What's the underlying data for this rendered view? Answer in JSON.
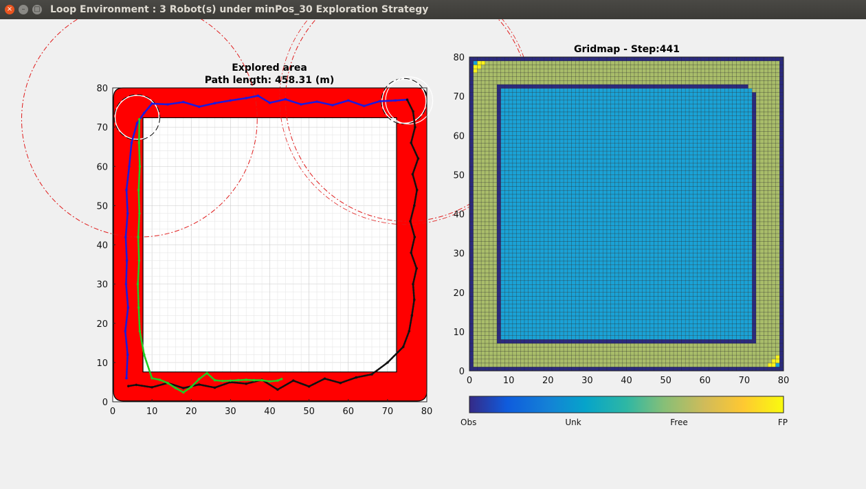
{
  "window": {
    "title": "Loop Environment : 3 Robot(s) under minPos_30 Exploration Strategy",
    "close_glyph": "×",
    "minimize_glyph": "–",
    "maximize_glyph": "□"
  },
  "colors": {
    "explored": "#ff0000",
    "robot1_path": "#1a1adf",
    "robot2_path": "#111111",
    "robot3_path": "#22cc22",
    "sensor_range": "#e01a1a",
    "grid_obs": "#2b2a7e",
    "grid_unk": "#1aa2d6",
    "grid_free": "#a9bd6a",
    "grid_fp": "#f9f21c"
  },
  "chart_data": [
    {
      "type": "scatter",
      "title": "Explored area",
      "subtitle": "Path length: 458.31 (m)",
      "xlim": [
        0,
        80
      ],
      "ylim": [
        0,
        80
      ],
      "xticks": [
        "0",
        "10",
        "20",
        "30",
        "40",
        "50",
        "60",
        "70",
        "80"
      ],
      "yticks": [
        "0",
        "10",
        "20",
        "30",
        "40",
        "50",
        "60",
        "70",
        "80"
      ],
      "grid": true,
      "series": [
        {
          "robot": 1,
          "color": "#1a1adf",
          "x": [
            3.5,
            3.8,
            3.2,
            3.9,
            3.4,
            3.6,
            3.3,
            3.8,
            3.5,
            4.2,
            4.8,
            6.2,
            8,
            10,
            14,
            18,
            22,
            26,
            30,
            34,
            37,
            40,
            44,
            48,
            52,
            56,
            60,
            64,
            68,
            72,
            75
          ],
          "y": [
            6,
            12,
            18,
            24,
            30,
            36,
            42,
            48,
            54,
            60,
            66,
            71,
            73.6,
            76,
            75.8,
            76.4,
            75.2,
            76.1,
            76.8,
            77.4,
            78,
            76.2,
            77.1,
            75.8,
            76.5,
            75.6,
            76.8,
            75.4,
            76.6,
            76.8,
            77
          ]
        },
        {
          "robot": 2,
          "color": "#111111",
          "x": [
            75,
            76.5,
            77,
            76,
            77.8,
            76.4,
            77.5,
            76.8,
            75.8,
            76.9,
            76,
            77.4,
            76.5,
            76.8,
            76.2,
            75.5,
            74,
            70,
            66,
            62,
            58,
            54,
            50,
            46,
            42,
            38,
            34,
            30,
            26,
            22,
            18,
            14,
            10,
            6,
            4
          ],
          "y": [
            77,
            74,
            70,
            66,
            62,
            58,
            54,
            50,
            46,
            42,
            38,
            34,
            30,
            26,
            22,
            18,
            14,
            10,
            7,
            6.2,
            4.8,
            5.9,
            3.9,
            5.4,
            3.1,
            5.6,
            4.6,
            5,
            3.6,
            4.4,
            3.5,
            4.8,
            3.7,
            4.3,
            4
          ]
        },
        {
          "robot": 3,
          "color": "#22cc22",
          "x": [
            6.8,
            6.7,
            6.9,
            6.6,
            6.8,
            6.5,
            6.7,
            6.4,
            6.6,
            6.9,
            8,
            10,
            12,
            14,
            16,
            18,
            20,
            22,
            24,
            26,
            28,
            30,
            32,
            34,
            36,
            38,
            40,
            42,
            43
          ],
          "y": [
            72,
            66,
            60,
            54,
            48,
            42,
            36,
            30,
            24,
            18,
            12,
            6,
            5.6,
            4.8,
            3.5,
            2.4,
            3.8,
            5.8,
            7.3,
            5.5,
            5.3,
            5.4,
            5.5,
            5.6,
            5.5,
            5.5,
            5.2,
            5.4,
            5.8
          ]
        }
      ]
    },
    {
      "type": "heatmap",
      "title": "Gridmap - Step:441",
      "xlim": [
        0,
        80
      ],
      "ylim": [
        0,
        80
      ],
      "xticks": [
        "0",
        "10",
        "20",
        "30",
        "40",
        "50",
        "60",
        "70",
        "80"
      ],
      "yticks": [
        "0",
        "10",
        "20",
        "30",
        "40",
        "50",
        "60",
        "70",
        "80"
      ],
      "size": 80,
      "classes": [
        "Obs",
        "Unk",
        "Free",
        "FP"
      ],
      "colorbar_labels": [
        "Obs",
        "Unk",
        "Free",
        "FP"
      ]
    }
  ]
}
